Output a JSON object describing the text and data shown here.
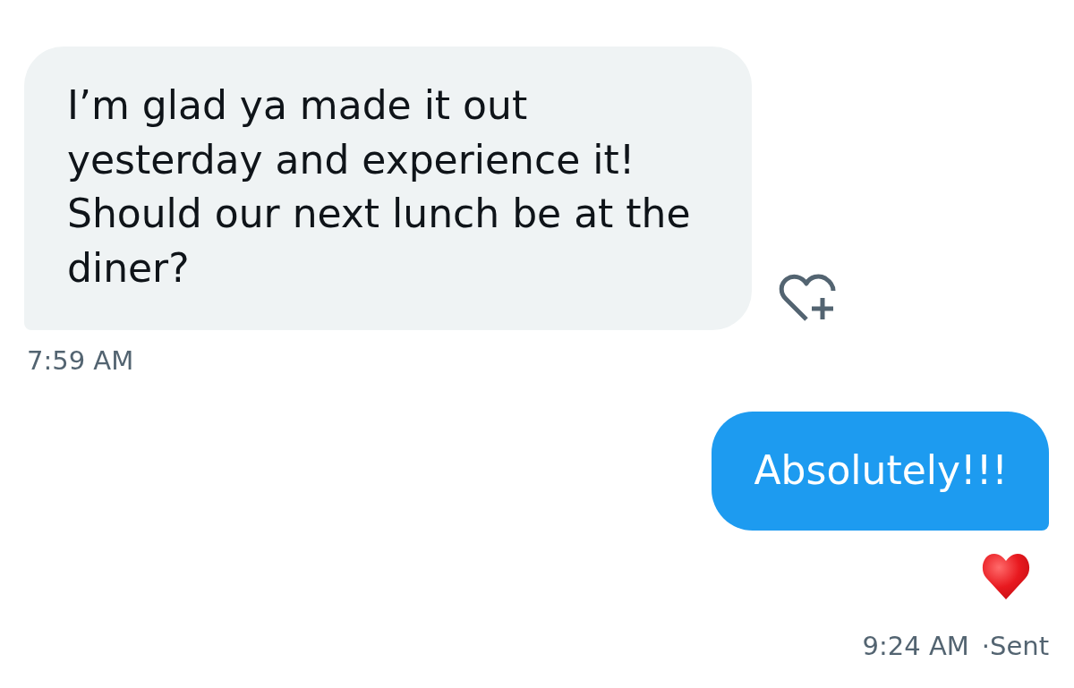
{
  "messages": [
    {
      "kind": "received",
      "text": "I’m glad ya made it out yesterday and experience it! Should our next lunch be at the diner?",
      "time": "7:59 AM",
      "reacted": false
    },
    {
      "kind": "sent",
      "text": "Absolutely!!!",
      "time": "9:24 AM",
      "status": "·Sent",
      "reacted": true
    }
  ]
}
